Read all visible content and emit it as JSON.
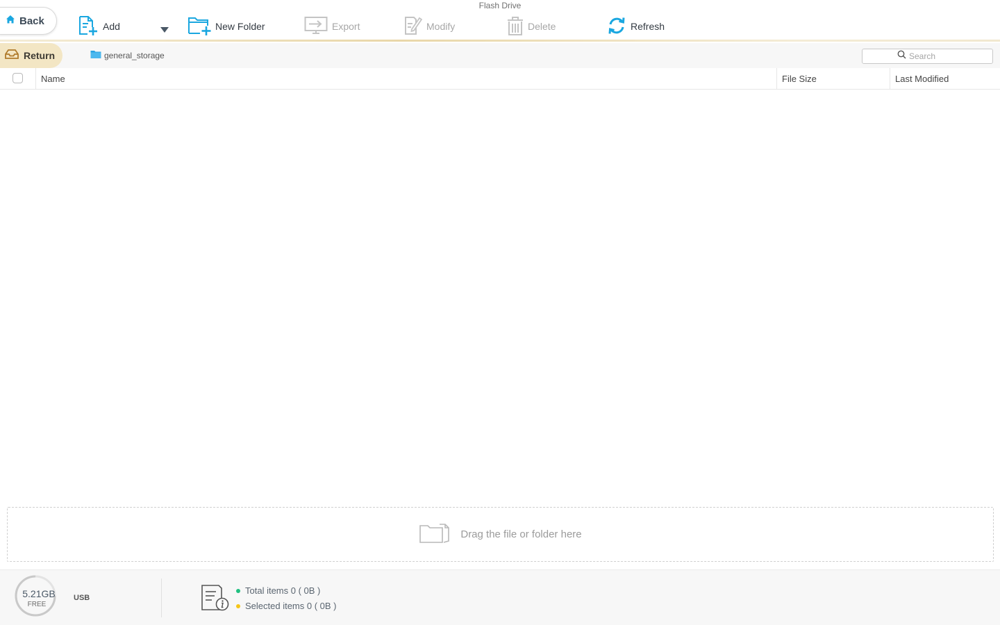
{
  "window": {
    "title": "Flash Drive"
  },
  "toolbar": {
    "back_label": "Back",
    "add_label": "Add",
    "new_folder_label": "New Folder",
    "export_label": "Export",
    "modify_label": "Modify",
    "delete_label": "Delete",
    "refresh_label": "Refresh",
    "accent_color": "#1aa7e0",
    "disabled_color": "#b5b5b5"
  },
  "pathbar": {
    "return_label": "Return",
    "current_folder": "general_storage",
    "search_placeholder": "Search"
  },
  "table": {
    "columns": [
      "Name",
      "File Size",
      "Last Modified"
    ],
    "rows": []
  },
  "dropzone": {
    "label": "Drag the file or folder here"
  },
  "footer": {
    "free_space": "5.21GB",
    "free_label": "FREE",
    "device": "USB",
    "total_items": "Total items 0 ( 0B )",
    "selected_items": "Selected items 0 ( 0B )",
    "total_color": "#20c080",
    "selected_color": "#f5c518"
  }
}
